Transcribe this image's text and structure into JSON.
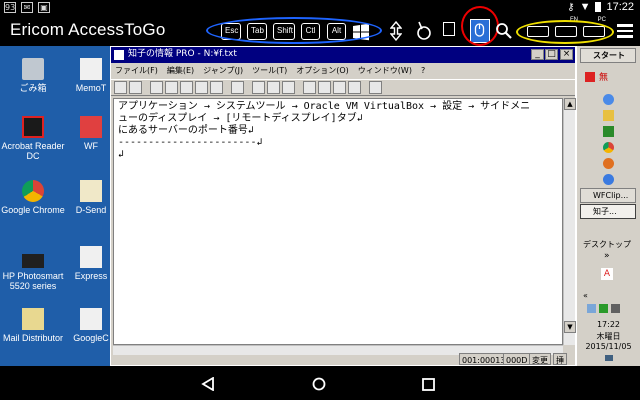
{
  "status_bar": {
    "left_icons": [
      "93",
      "message-icon",
      "image-icon"
    ],
    "time": "17:22"
  },
  "toolbar": {
    "brand": "Ericom AccessToGo",
    "keys": [
      "Esc",
      "Tab",
      "Shift",
      "Ctl",
      "Alt"
    ],
    "kbd_fn_label": "FN",
    "kbd_pc_label": "PC",
    "highlight_colors": {
      "blue": "#1e64ff",
      "red": "#e00000",
      "yellow": "#f0e000"
    }
  },
  "desktop": {
    "background": "#1f5ea9",
    "icons": [
      {
        "label": "ごみ箱"
      },
      {
        "label": "MemoT"
      },
      {
        "label": "Acrobat Reader DC"
      },
      {
        "label": "WF"
      },
      {
        "label": "Google Chrome"
      },
      {
        "label": "D-Send"
      },
      {
        "label": "HP Photosmart 5520 series"
      },
      {
        "label": "Express"
      },
      {
        "label": "Mail Distributor"
      },
      {
        "label": "GoogleC"
      }
    ]
  },
  "window": {
    "title": "知子の情報 PRO - N:¥f.txt",
    "menu": [
      "ファイル(F)",
      "編集(E)",
      "ジャンプ(J)",
      "ツール(T)",
      "オプション(O)",
      "ウィンドウ(W)",
      "?"
    ],
    "content_lines": [
      "アプリケーション → システムツール → Oracle VM VirtualBox → 設定 → サイドメニ",
      "ューのディスプレイ → [リモートディスプレイ]タブ↲",
      "にあるサーバーのポート番号↲",
      "-----------------------↲",
      "↲"
    ],
    "status": {
      "position": "001:00013",
      "col": "000D",
      "mode": "変更",
      "extra": "挿"
    }
  },
  "taskbar": {
    "start_label": "スタート",
    "tasks": [
      "WFClip...",
      "知子..."
    ],
    "desktop_label": "デスクトップ",
    "chevron": "»",
    "clock_time": "17:22",
    "clock_day": "木曜日",
    "clock_date": "2015/11/05"
  },
  "nav": {
    "back": "back-icon",
    "home": "home-icon",
    "recents": "recents-icon"
  }
}
